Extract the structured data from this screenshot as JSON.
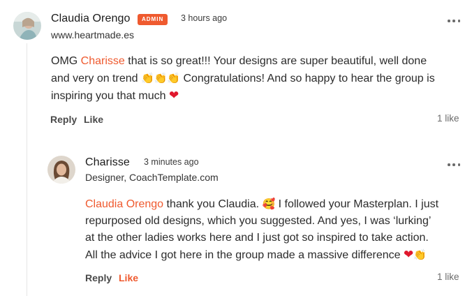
{
  "comment": {
    "author": "Claudia Orengo",
    "badge": "ADMIN",
    "time": "3 hours ago",
    "subtitle": "www.heartmade.es",
    "text": {
      "pre": "OMG ",
      "mention": "Charisse",
      "line1_rest": " that is so great!!! Your designs are super beautiful, well done",
      "line2_start": "and very on trend ",
      "claps": "👏👏👏",
      "line2_rest": " Congratulations! And so happy to hear the group is",
      "line3": "inspiring you that much ",
      "heart": "❤"
    },
    "reply_label": "Reply",
    "like_label": "Like",
    "likes_count": "1 like"
  },
  "reply": {
    "author": "Charisse",
    "time": "3 minutes ago",
    "subtitle": "Designer, CoachTemplate.com",
    "text": {
      "mention": "Claudia Orengo",
      "line1_rest": " thank you Claudia. ",
      "face": "🥰",
      "line1_end": " I followed your Masterplan. I just",
      "line2": "repurposed old designs, which you suggested. And yes, I was ‘lurking’",
      "line3": "at the other ladies works here and I just got so inspired to take action.",
      "line4": "All the advice I got here in the group made a massive difference ",
      "heart": "❤",
      "clap": "👏"
    },
    "reply_label": "Reply",
    "like_label": "Like",
    "likes_count": "1 like"
  },
  "colors": {
    "accent": "#ef5a2f",
    "heart": "#e0182d"
  },
  "icons": {
    "more": "more-horizontal-icon"
  }
}
